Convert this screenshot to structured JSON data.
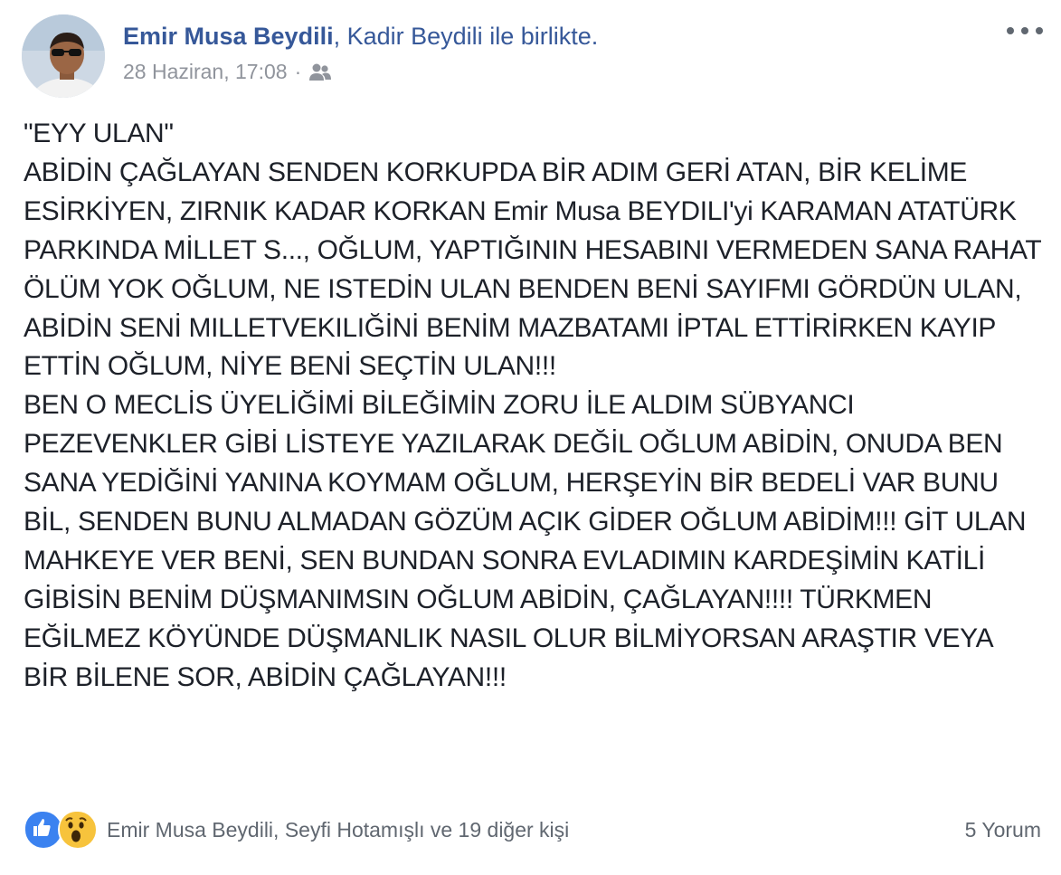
{
  "header": {
    "author": "Emir Musa Beydili",
    "separator": ",",
    "tagged": "Kadir Beydili",
    "with_text": "ile birlikte.",
    "timestamp": "28 Haziran, 17:08",
    "dot": "·",
    "privacy_icon": "friends-icon",
    "more_icon": "more-options-icon"
  },
  "post": {
    "text": "\"EYY ULAN\"\nABİDİN ÇAĞLAYAN SENDEN KORKUPDA BİR ADIM GERİ ATAN, BİR KELİME ESİRKİYEN, ZIRNIK KADAR KORKAN Emir Musa BEYDILI'yi KARAMAN ATATÜRK PARKINDA MİLLET S..., OĞLUM, YAPTIĞININ HESABINI VERMEDEN SANA RAHAT ÖLÜM YOK OĞLUM, NE ISTEDİN ULAN BENDEN BENİ SAYIFMI GÖRDÜN ULAN, ABİDİN SENİ MILLETVEKILIĞİNİ BENİM MAZBATAMI İPTAL ETTİRİRKEN KAYIP ETTİN OĞLUM, NİYE BENİ SEÇTİN ULAN!!!\nBEN O MECLİS ÜYELİĞİMİ BİLEĞİMİN ZORU İLE ALDIM SÜBYANCI PEZEVENKLER GİBİ LİSTEYE YAZILARAK DEĞİL OĞLUM ABİDİN, ONUDA BEN SANA YEDİĞİNİ YANINA KOYMAM OĞLUM, HERŞEYİN BİR BEDELİ VAR BUNU BİL, SENDEN BUNU ALMADAN GÖZÜM AÇIK GİDER OĞLUM ABİDİM!!! GİT ULAN MAHKEYE VER BENİ, SEN BUNDAN SONRA EVLADIMIN KARDEŞİMİN KATİLİ GİBİSİN BENİM DÜŞMANIMSIN OĞLUM ABİDİN, ÇAĞLAYAN!!!! TÜRKMEN EĞİLMEZ KÖYÜNDE DÜŞMANLIK NASIL OLUR BİLMİYORSAN ARAŞTIR VEYA BİR BİLENE SOR, ABİDİN ÇAĞLAYAN!!!"
  },
  "footer": {
    "reaction_icons": [
      "like-icon",
      "wow-icon"
    ],
    "reactors": "Emir Musa Beydili, Seyfi Hotamışlı ve 19 diğer kişi",
    "comments": "5 Yorum"
  },
  "colors": {
    "link": "#365899",
    "meta": "#90949c",
    "text": "#1d2129",
    "like": "#3b82f0",
    "wow": "#f7c33c"
  }
}
